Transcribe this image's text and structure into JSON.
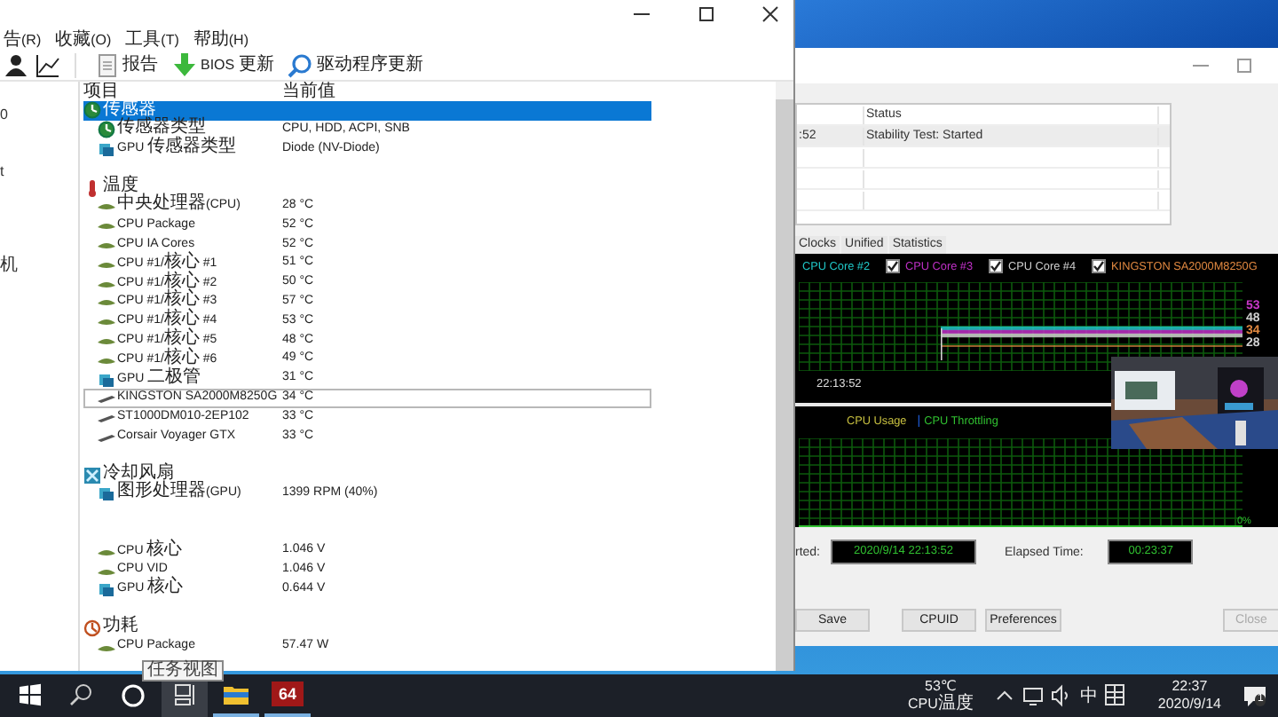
{
  "aida": {
    "menu": [
      "告(R)",
      "收藏(O)",
      "工具(T)",
      "帮助(H)"
    ],
    "toolbar": [
      {
        "kind": "person"
      },
      {
        "kind": "chart"
      },
      {
        "kind": "report",
        "label": "报告"
      },
      {
        "kind": "bios",
        "label": "BIOS 更新"
      },
      {
        "kind": "driver",
        "label": "驱动程序更新"
      }
    ],
    "tree": [
      "0",
      "t",
      "机"
    ],
    "columns": [
      "项目",
      "当前值"
    ],
    "groups": [
      {
        "label": "传感器",
        "kind": "sensor",
        "selected": true,
        "items": [
          {
            "label": "传感器类型",
            "value": "CPU, HDD, ACPI, SNB",
            "kind": "sensor",
            "selected": false,
            "focused": false
          },
          {
            "label": "GPU 传感器类型",
            "value": "Diode  (NV-Diode)",
            "kind": "gpu",
            "selected": false,
            "focused": false
          }
        ]
      },
      {
        "label": "温度",
        "kind": "temp",
        "selected": false,
        "items": [
          {
            "label": "中央处理器(CPU)",
            "value": "28 °C",
            "kind": "chip",
            "selected": false,
            "focused": false
          },
          {
            "label": "CPU Package",
            "value": "52 °C",
            "kind": "chip",
            "selected": false,
            "focused": false
          },
          {
            "label": "CPU IA Cores",
            "value": "52 °C",
            "kind": "chip",
            "selected": false,
            "focused": false
          },
          {
            "label": "CPU #1/核心 #1",
            "value": "51 °C",
            "kind": "chip",
            "selected": false,
            "focused": false
          },
          {
            "label": "CPU #1/核心 #2",
            "value": "50 °C",
            "kind": "chip",
            "selected": false,
            "focused": false
          },
          {
            "label": "CPU #1/核心 #3",
            "value": "57 °C",
            "kind": "chip",
            "selected": false,
            "focused": false
          },
          {
            "label": "CPU #1/核心 #4",
            "value": "53 °C",
            "kind": "chip",
            "selected": false,
            "focused": false
          },
          {
            "label": "CPU #1/核心 #5",
            "value": "48 °C",
            "kind": "chip",
            "selected": false,
            "focused": false
          },
          {
            "label": "CPU #1/核心 #6",
            "value": "49 °C",
            "kind": "chip",
            "selected": false,
            "focused": false
          },
          {
            "label": "GPU 二极管",
            "value": "31 °C",
            "kind": "gpu",
            "selected": false,
            "focused": false
          },
          {
            "label": "KINGSTON SA2000M8250G",
            "value": "34 °C",
            "kind": "disk",
            "selected": false,
            "focused": true
          },
          {
            "label": "ST1000DM010-2EP102",
            "value": "33 °C",
            "kind": "disk",
            "selected": false,
            "focused": false
          },
          {
            "label": "Corsair Voyager GTX",
            "value": "33 °C",
            "kind": "disk",
            "selected": false,
            "focused": false
          }
        ]
      },
      {
        "label": "冷却风扇",
        "kind": "fan",
        "selected": false,
        "items": [
          {
            "label": "图形处理器(GPU)",
            "value": "1399 RPM  (40%)",
            "kind": "gpu",
            "selected": false,
            "focused": false
          }
        ]
      },
      {
        "items": [
          {
            "label": "CPU 核心",
            "value": "1.046 V",
            "kind": "chip",
            "selected": false,
            "focused": false
          },
          {
            "label": "CPU VID",
            "value": "1.046 V",
            "kind": "chip",
            "selected": false,
            "focused": false
          },
          {
            "label": "GPU 核心",
            "value": "0.644 V",
            "kind": "gpu",
            "selected": false,
            "focused": false
          }
        ]
      },
      {
        "label": "功耗",
        "kind": "power",
        "selected": false,
        "items": [
          {
            "label": "CPU Package",
            "value": "57.47 W",
            "kind": "chip",
            "selected": false,
            "focused": false
          }
        ]
      }
    ]
  },
  "stability": {
    "log": {
      "headers": [
        "Status"
      ],
      "rows": [
        {
          "cells": [
            ":52",
            "Stability Test: Started"
          ],
          "selected": true
        }
      ]
    },
    "tabs": [
      {
        "label": "Clocks",
        "selected": false
      },
      {
        "label": "Unified",
        "selected": false
      },
      {
        "label": "Statistics",
        "selected": false
      }
    ],
    "legend": [
      {
        "kind": "label",
        "label": "CPU Core #2",
        "color": "#20c8c8"
      },
      {
        "kind": "check",
        "label": "CPU Core #3",
        "color": "#c030c8",
        "checked": true
      },
      {
        "kind": "check",
        "label": "CPU Core #4",
        "color": "#d0d0d0",
        "checked": true
      },
      {
        "kind": "check",
        "label": "KINGSTON SA2000M8250G",
        "color": "#e08840",
        "checked": true
      }
    ],
    "readings": [
      {
        "text": "53",
        "color": "#c838c8"
      },
      {
        "text": "48",
        "color": "#d0d0d0"
      },
      {
        "text": "34",
        "color": "#e08840"
      },
      {
        "text": "28",
        "color": "#d0d0d0"
      }
    ],
    "time": "22:13:52",
    "lower_legend": [
      {
        "label": "CPU Usage",
        "color": "#c8c040"
      },
      {
        "label": "CPU Throttling",
        "color": "#30c030"
      }
    ],
    "lower_separator": "|",
    "lower_reading": "0%",
    "started_label": "rted:",
    "started": "2020/9/14 22:13:52",
    "elapsed_label": "Elapsed Time:",
    "elapsed": "00:23:37",
    "buttons": [
      {
        "label": "Save",
        "disabled": false
      },
      {
        "label": "CPUID",
        "disabled": false
      },
      {
        "label": "Preferences",
        "disabled": false
      },
      {
        "label": "Close",
        "disabled": true
      }
    ]
  },
  "taskbar": {
    "apps": [
      {
        "kind": "start"
      },
      {
        "kind": "search"
      },
      {
        "kind": "cortana"
      },
      {
        "kind": "taskview",
        "hovered": true
      },
      {
        "kind": "explorer",
        "hovered": false
      },
      {
        "kind": "aida",
        "label": "64",
        "hovered": false
      }
    ],
    "tooltip": "任务视图",
    "temp": "53℃",
    "temp_label": "CPU温度",
    "tray": [
      {
        "kind": "caret"
      },
      {
        "kind": "network"
      },
      {
        "kind": "volume"
      },
      {
        "kind": "ime",
        "label": "中"
      },
      {
        "kind": "grid"
      }
    ],
    "time": "22:37",
    "date": "2020/9/14",
    "notifications": "1"
  }
}
